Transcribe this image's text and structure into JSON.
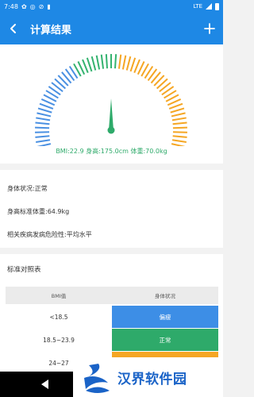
{
  "status_bar": {
    "time": "7:48",
    "network": "LTE",
    "icons": [
      "settings-icon",
      "at-icon",
      "signal-off-icon",
      "sd-card-icon"
    ]
  },
  "app_bar": {
    "title": "计算结果",
    "back_icon": "back-arrow-icon",
    "add_icon": "plus-icon",
    "color": "#1e88e5"
  },
  "gauge": {
    "bmi_line": "BMI:22.9  身高:175.0cm  体重:70.0kg",
    "needle_color": "#2eaa6a",
    "colors": {
      "low": "#4a90e2",
      "normal": "#34b36f",
      "high": "#f5a623"
    },
    "bmi": 22.9
  },
  "info": {
    "status": "身体状况:正常",
    "standard_weight": "身高标准体重:64.9kg",
    "risk": "相关疾病发病危险性:平均水平"
  },
  "table": {
    "title": "标准对照表",
    "headers": [
      "BMI值",
      "身体状况"
    ],
    "rows": [
      {
        "range": "<18.5",
        "status": "偏瘦",
        "color": "#3d8ee6"
      },
      {
        "range": "18.5~23.9",
        "status": "正常",
        "color": "#2eaa6a"
      },
      {
        "range": "24~27",
        "status": "",
        "color": "#f5a623"
      }
    ]
  },
  "watermark": {
    "text": "汉界软件园"
  }
}
